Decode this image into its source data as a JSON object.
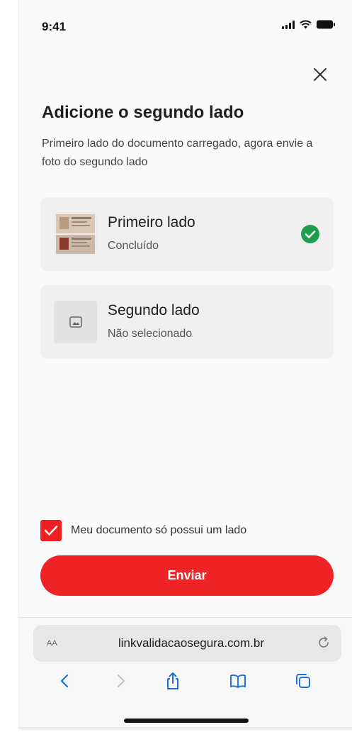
{
  "status_bar": {
    "time": "9:41"
  },
  "header": {
    "title": "Adicione o segundo lado",
    "subtitle": "Primeiro lado do documento carregado, agora envie a foto do segundo lado"
  },
  "cards": [
    {
      "title": "Primeiro lado",
      "status": "Concluído",
      "state": "done"
    },
    {
      "title": "Segundo lado",
      "status": "Não selecionado",
      "state": "empty"
    }
  ],
  "single_side": {
    "label": "Meu documento só possui um lado",
    "checked": true
  },
  "send_button": {
    "label": "Enviar"
  },
  "browser": {
    "text_size_label": "AA",
    "url": "linkvalidacaosegura.com.br"
  },
  "colors": {
    "accent": "#EF2427",
    "success": "#1E9E4E",
    "browser_blue": "#1A6EE0"
  },
  "icons": [
    "close-icon",
    "check-circle-icon",
    "image-placeholder-icon",
    "checkbox-check-icon",
    "reload-icon",
    "back-icon",
    "forward-icon",
    "share-icon",
    "bookmarks-icon",
    "tabs-icon"
  ]
}
